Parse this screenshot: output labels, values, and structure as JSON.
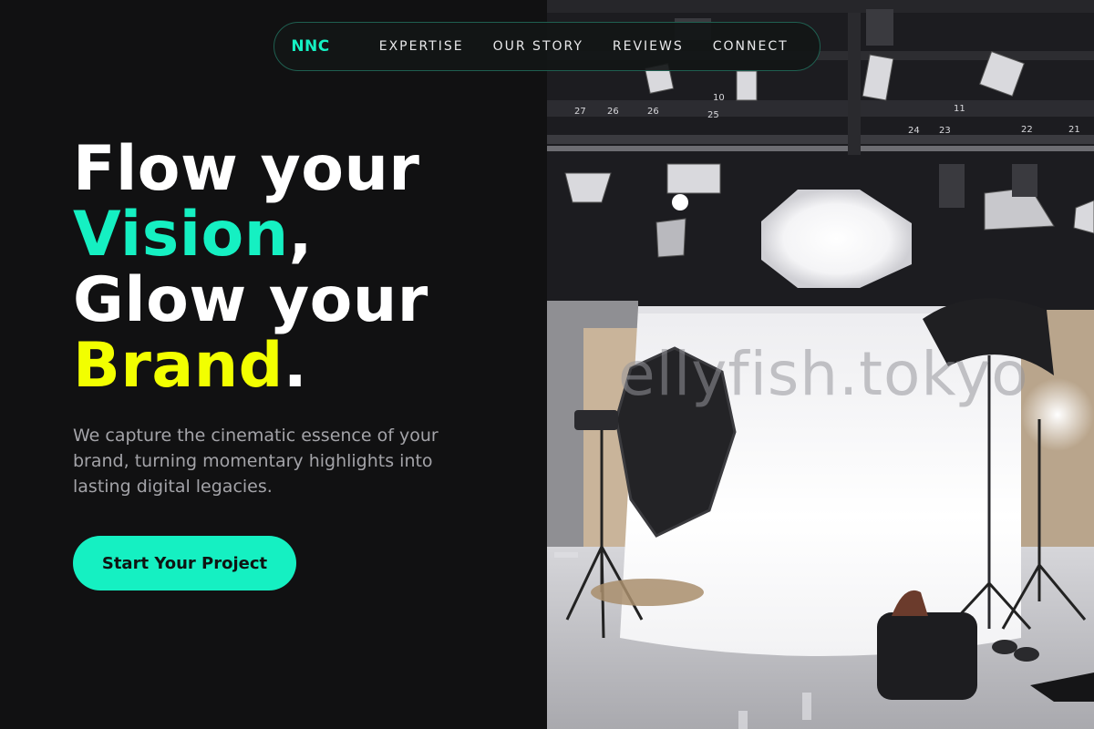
{
  "nav": {
    "brand": "NNC",
    "links": [
      "EXPERTISE",
      "OUR STORY",
      "REVIEWS",
      "CONNECT"
    ]
  },
  "hero": {
    "line1": "Flow your",
    "line2_accent": "Vision",
    "line2_end": ",",
    "line3": "Glow your",
    "line4_accent": "Brand",
    "line4_end": ".",
    "description": "We capture the cinematic essence of your brand, turning momentary highlights into lasting digital legacies.",
    "cta_label": "Start Your Project"
  },
  "image": {
    "watermark": "ellyfish.tokyo",
    "truss_numbers": [
      "27",
      "26",
      "26",
      "25",
      "10",
      "11",
      "24",
      "23",
      "22",
      "21"
    ]
  },
  "colors": {
    "background": "#111112",
    "accent_teal": "#15f0c2",
    "accent_yellow": "#f2ff00",
    "body_text": "#a3a3a8"
  }
}
